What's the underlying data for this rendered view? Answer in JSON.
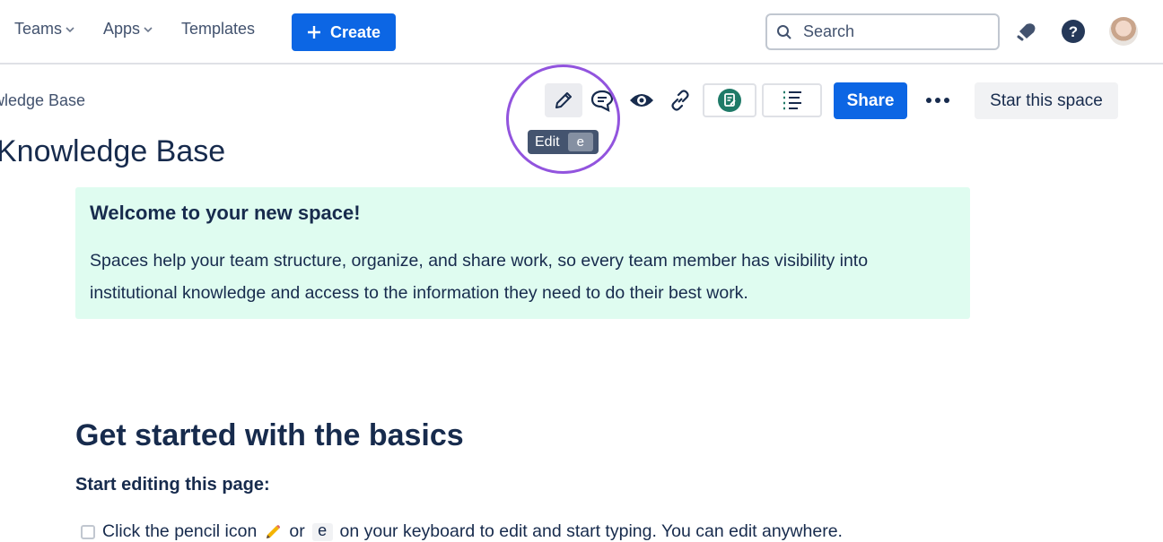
{
  "topbar": {
    "nav": [
      {
        "label": "Teams",
        "has_dropdown": true
      },
      {
        "label": "Apps",
        "has_dropdown": true
      },
      {
        "label": "Templates",
        "has_dropdown": false
      }
    ],
    "create_label": "Create",
    "search_placeholder": "Search",
    "icons": [
      "notification-icon",
      "help-icon",
      "avatar"
    ]
  },
  "page": {
    "breadcrumb": "wledge Base",
    "title": "Knowledge Base"
  },
  "toolbar": {
    "edit_tooltip_label": "Edit",
    "edit_tooltip_key": "e",
    "share_label": "Share",
    "star_label": "Star this space",
    "icons": [
      "pencil-icon",
      "comment-icon",
      "watch-eye-icon",
      "copy-link-icon",
      "app-badge-icon",
      "outline-list-icon",
      "more-icon"
    ]
  },
  "panel": {
    "heading": "Welcome to your new space!",
    "body": "Spaces help your team structure, organize, and share work, so every team member has visibility into institutional knowledge and access to the information they need to do their best work."
  },
  "content": {
    "heading": "Get started with the basics",
    "subheading": "Start editing this page:",
    "task_prefix": "Click the pencil icon",
    "task_or": "or",
    "task_key": "e",
    "task_suffix": "on your keyboard to edit and start typing. You can edit anywhere."
  },
  "colors": {
    "primary": "#0c66e4",
    "panel_bg": "#dffcf0",
    "highlight": "#9254de",
    "text": "#172b4d"
  }
}
